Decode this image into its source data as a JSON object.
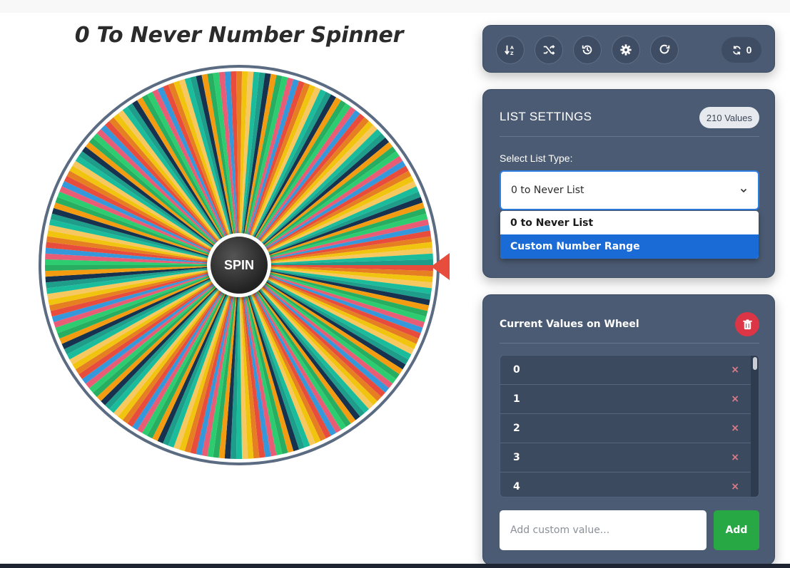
{
  "page": {
    "title": "0 To Never Number Spinner"
  },
  "wheel": {
    "spin_label": "SPIN",
    "segment_count": 210,
    "palette": [
      "#e74c3c",
      "#f39c12",
      "#f1c40f",
      "#2ecc71",
      "#1abc9c",
      "#3498db",
      "#16324f",
      "#e67e22",
      "#27ae60",
      "#f6c85f",
      "#e85d75",
      "#1f9d8b"
    ],
    "pointer_color": "#e74c3c"
  },
  "toolbar": {
    "buttons": [
      {
        "icon": "sort-icon"
      },
      {
        "icon": "shuffle-icon"
      },
      {
        "icon": "history-icon"
      },
      {
        "icon": "gear-icon"
      },
      {
        "icon": "redo-icon"
      }
    ],
    "spin_count": "0"
  },
  "settings": {
    "title": "LIST SETTINGS",
    "values_badge": "210 Values",
    "select_label": "Select List Type:",
    "selected": "0 to Never List",
    "options": [
      "0 to Never List",
      "Custom Number Range"
    ]
  },
  "values_panel": {
    "title": "Current Values on Wheel",
    "items": [
      "0",
      "1",
      "2",
      "3",
      "4"
    ],
    "remove_symbol": "×",
    "add_placeholder": "Add custom value...",
    "add_label": "Add"
  }
}
